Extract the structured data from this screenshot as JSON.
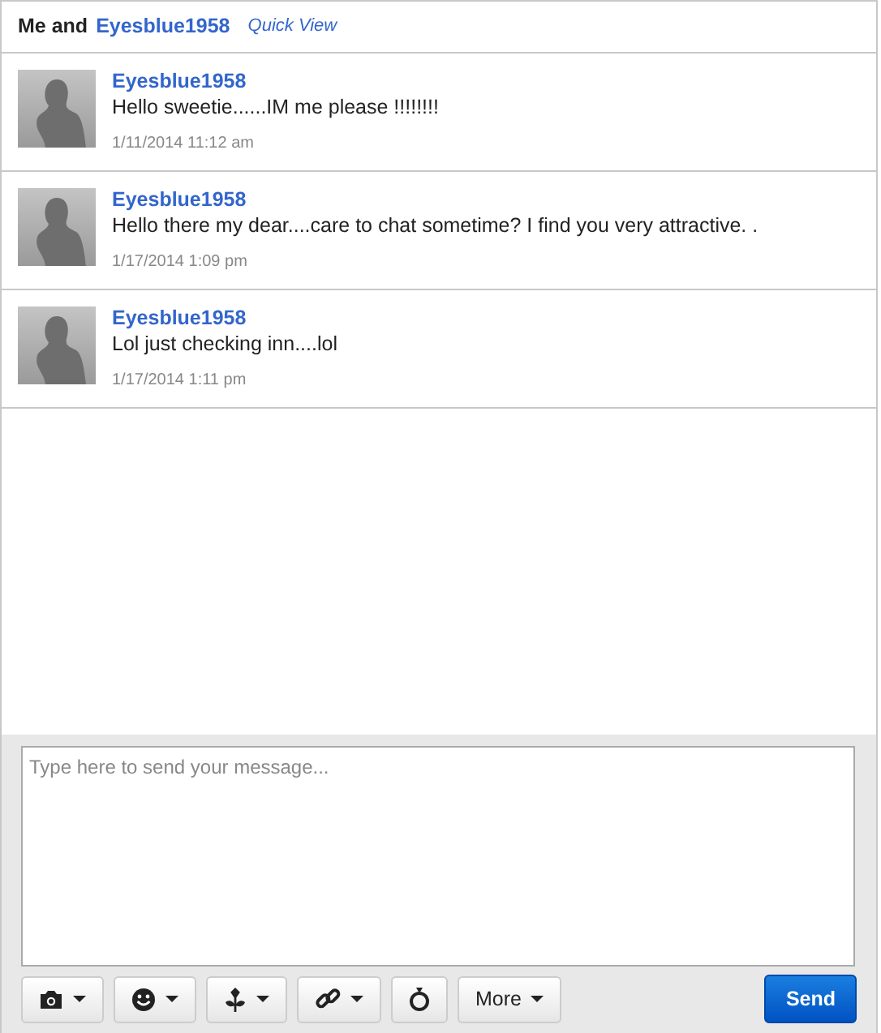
{
  "header": {
    "prefix": "Me and",
    "contact": "Eyesblue1958",
    "link": "Quick View"
  },
  "messages": [
    {
      "sender": "Eyesblue1958",
      "text": "Hello sweetie......IM me please !!!!!!!!",
      "time": "1/11/2014 11:12 am"
    },
    {
      "sender": "Eyesblue1958",
      "text": "Hello there my dear....care to chat sometime? I find you very attractive. .",
      "time": "1/17/2014 1:09 pm"
    },
    {
      "sender": "Eyesblue1958",
      "text": "Lol just checking inn....lol",
      "time": "1/17/2014 1:11 pm"
    }
  ],
  "compose": {
    "placeholder": "Type here to send your message..."
  },
  "tools": [
    {
      "kind": "camera",
      "dropdown": true
    },
    {
      "kind": "smiley",
      "dropdown": true
    },
    {
      "kind": "flower",
      "dropdown": true
    },
    {
      "kind": "link",
      "dropdown": true
    },
    {
      "kind": "ring",
      "dropdown": false
    },
    {
      "kind": "text",
      "label": "More",
      "dropdown": true
    }
  ],
  "send": "Send"
}
